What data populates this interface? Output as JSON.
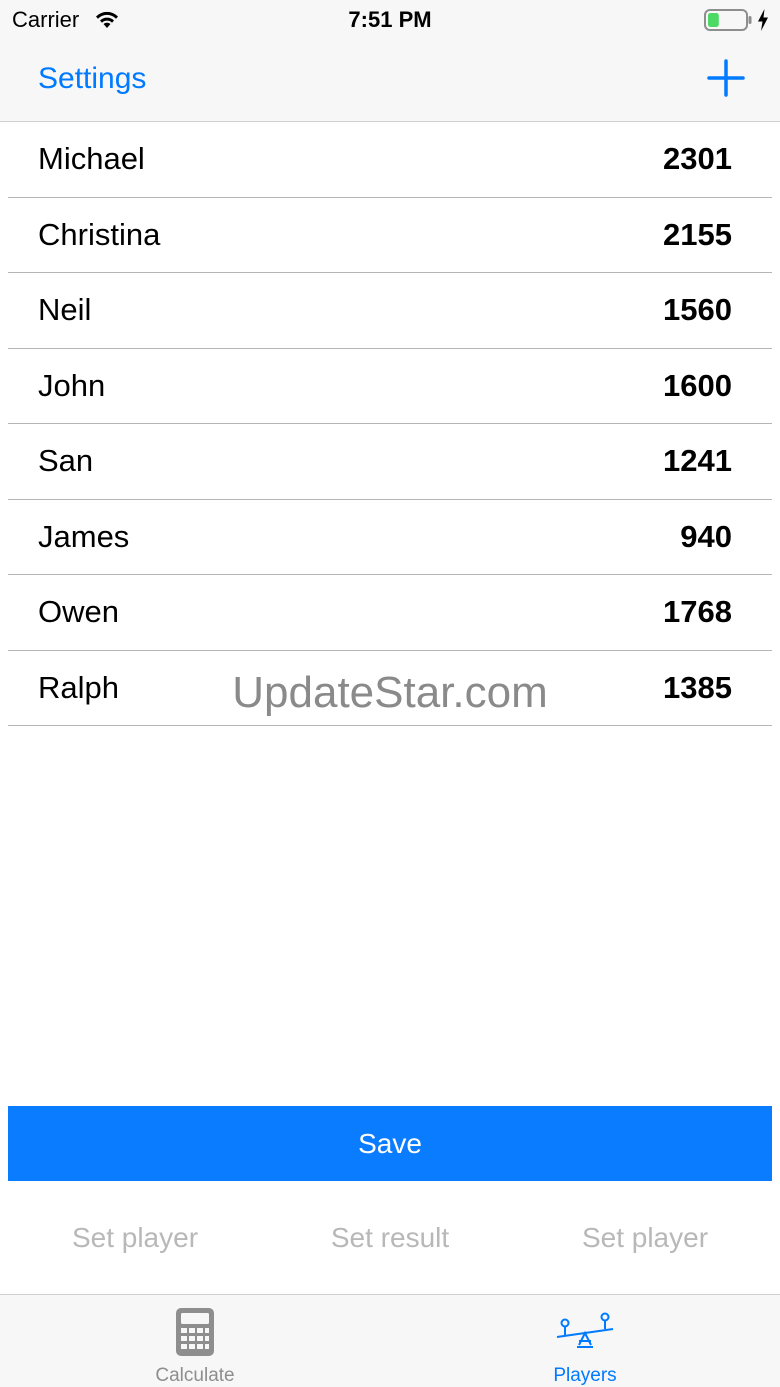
{
  "status_bar": {
    "carrier": "Carrier",
    "time": "7:51 PM",
    "battery_level": 0.3,
    "battery_color": "#4cd964"
  },
  "nav": {
    "left_button": "Settings",
    "right_icon": "plus-icon",
    "accent": "#007aff"
  },
  "players": [
    {
      "name": "Michael",
      "score": "2301"
    },
    {
      "name": "Christina",
      "score": "2155"
    },
    {
      "name": "Neil",
      "score": "1560"
    },
    {
      "name": "John",
      "score": "1600"
    },
    {
      "name": "San",
      "score": "1241"
    },
    {
      "name": "James",
      "score": "940"
    },
    {
      "name": "Owen",
      "score": "1768"
    },
    {
      "name": "Ralph",
      "score": "1385"
    }
  ],
  "watermark": "UpdateStar.com",
  "save_button": {
    "label": "Save",
    "color": "#0a7cff"
  },
  "actions": [
    "Set player",
    "Set result",
    "Set player"
  ],
  "tabs": [
    {
      "label": "Calculate",
      "icon": "calculator-icon",
      "active": false
    },
    {
      "label": "Players",
      "icon": "seesaw-icon",
      "active": true
    }
  ]
}
